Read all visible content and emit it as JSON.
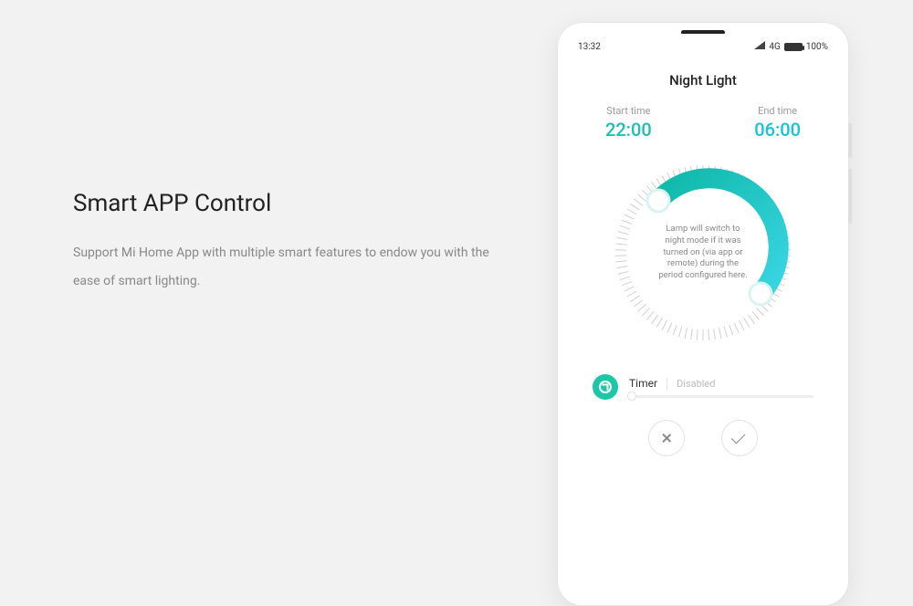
{
  "left": {
    "title": "Smart APP Control",
    "desc": "Support Mi Home App with multiple smart features to endow you with the ease of smart lighting."
  },
  "status": {
    "time": "13:32",
    "network": "4G",
    "battery": "100%"
  },
  "screen": {
    "title": "Night Light",
    "start": {
      "label": "Start time",
      "value": "22:00"
    },
    "end": {
      "label": "End time",
      "value": "06:00"
    },
    "center_text": "Lamp will switch to night mode if it was turned on (via app or remote) during the period configured here.",
    "timer": {
      "label": "Timer",
      "status": "Disabled"
    }
  },
  "colors": {
    "arc_start": "#0fb8a8",
    "arc_end": "#39d6e4"
  }
}
